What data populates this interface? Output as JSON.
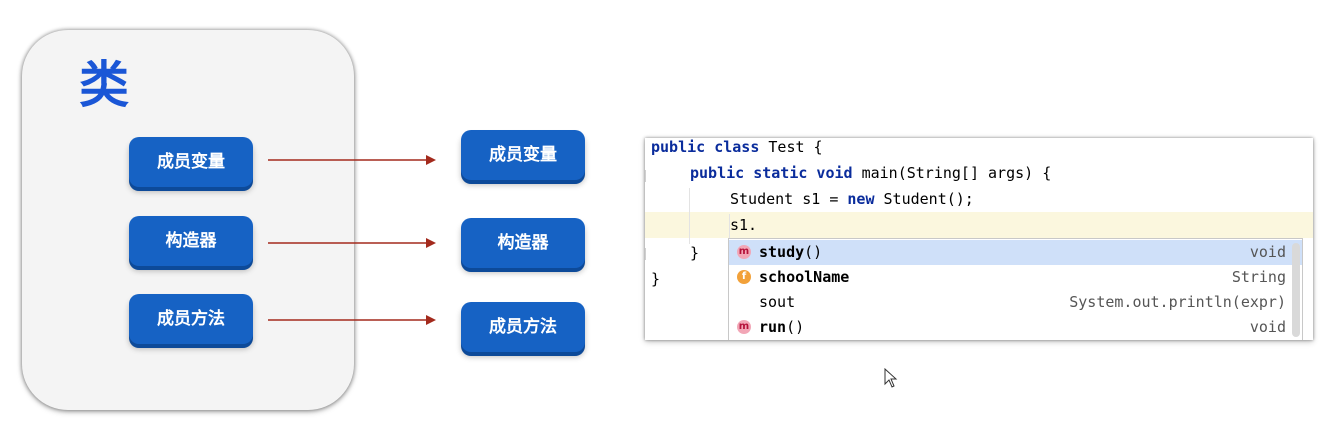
{
  "left_class": {
    "title": "类",
    "items": [
      "成员变量",
      "构造器",
      "成员方法"
    ]
  },
  "right_items": [
    "成员变量",
    "构造器",
    "成员方法"
  ],
  "arrow_color": "#a32a1d",
  "code": {
    "line1_kw": "public class",
    "line1_rest": " Test {",
    "line2_kw": "public static void",
    "line2_rest": " main(String[] args) {",
    "line3_a": "Student s1 = ",
    "line3_kw": "new",
    "line3_b": " Student();",
    "line4": "s1.",
    "line5": "}",
    "line6": "}"
  },
  "autocomplete": [
    {
      "icon": "m",
      "icon_name": "method-icon",
      "name": "study",
      "suffix": "()",
      "type": "void",
      "selected": true
    },
    {
      "icon": "f",
      "icon_name": "field-icon",
      "name": "schoolName",
      "suffix": "",
      "type": "String",
      "selected": false
    },
    {
      "icon": "",
      "icon_name": "",
      "name": "sout",
      "suffix": "",
      "type": "System.out.println(expr)",
      "selected": false
    },
    {
      "icon": "m",
      "icon_name": "method-icon",
      "name": "run",
      "suffix": "()",
      "type": "void",
      "selected": false
    }
  ]
}
